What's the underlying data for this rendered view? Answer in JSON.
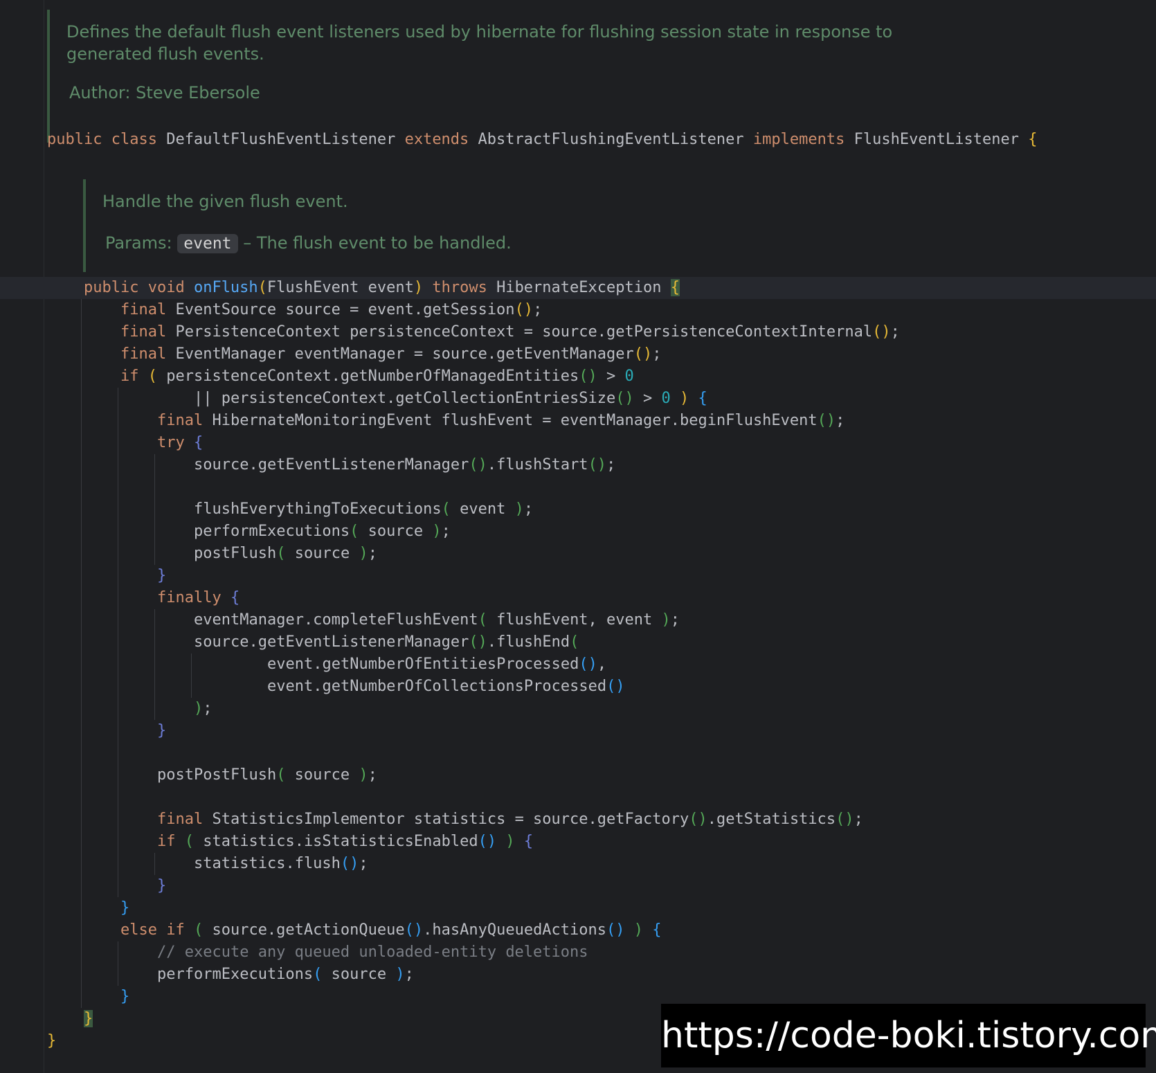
{
  "doc_class": {
    "line1": "Defines the default flush event listeners used by hibernate for flushing session state in response to",
    "line2": "generated flush events.",
    "author_label": "Author:",
    "author_name": "Steve Ebersole"
  },
  "doc_method": {
    "summary": "Handle the given flush event.",
    "params_label": "Params:",
    "param_name": "event",
    "param_desc": "– The flush event to be handled."
  },
  "code": {
    "class_decl": [
      "public class",
      " DefaultFlushEventListener ",
      "extends",
      " AbstractFlushingEventListener ",
      "implements",
      " FlushEventListener ",
      "{"
    ],
    "method_decl": [
      "public void",
      " ",
      "onFlush",
      "(",
      "FlushEvent event",
      ")",
      " ",
      "throws",
      " HibernateException ",
      "{"
    ],
    "comment": "// execute any queued unloaded-entity deletions"
  },
  "watermark": "https://code-boki.tistory.com",
  "colors": {
    "background": "#1e1f22",
    "keyword": "#cf8e6d",
    "method": "#56a8f5",
    "number": "#2aacb8",
    "doc": "#5f8c6a",
    "comment": "#7a7e85",
    "text": "#bcbec4"
  }
}
